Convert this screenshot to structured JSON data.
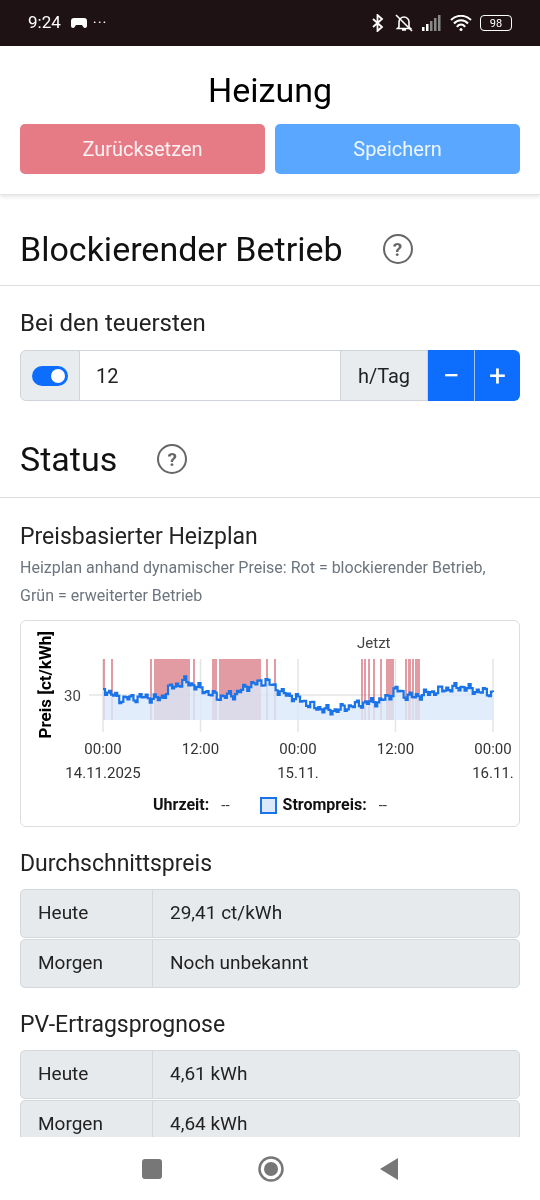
{
  "status_bar": {
    "time": "9:24",
    "more": "···",
    "battery": "98"
  },
  "header": {
    "title": "Heizung",
    "buttons": [
      {
        "label": "Zurücksetzen",
        "kind": "reset"
      },
      {
        "label": "Speichern",
        "kind": "save"
      }
    ]
  },
  "blocking": {
    "title": "Blockierender Betrieb",
    "help": "?",
    "label": "Bei den teuersten",
    "toggle_on": true,
    "value": "12",
    "unit": "h/Tag",
    "minus": "−",
    "plus": "+"
  },
  "status": {
    "title": "Status",
    "help": "?"
  },
  "plan": {
    "title": "Preisbasierter Heizplan",
    "description": "Heizplan anhand dynamischer Preise: Rot = blockierender Betrieb, Grün = erweiterter Betrieb",
    "chart": {
      "ylabel": "Preis [ct/kWh]",
      "ytick": "30",
      "now_label": "Jetzt",
      "xticks": [
        {
          "time": "00:00",
          "date": "14.11.2025"
        },
        {
          "time": "12:00"
        },
        {
          "time": "00:00",
          "date": "15.11."
        },
        {
          "time": "12:00"
        },
        {
          "time": "00:00",
          "date": "16.11."
        }
      ],
      "legend": [
        {
          "label": "Uhrzeit:",
          "value": "--",
          "kind": "plain"
        },
        {
          "label": "Strompreis:",
          "value": "--",
          "kind": "swatch"
        }
      ]
    }
  },
  "tables": [
    {
      "title": "Durchschnittspreis",
      "rows": [
        {
          "label": "Heute",
          "value": "29,41 ct/kWh"
        },
        {
          "label": "Morgen",
          "value": "Noch unbekannt"
        }
      ]
    },
    {
      "title": "PV-Ertragsprognose",
      "rows": [
        {
          "label": "Heute",
          "value": "4,61 kWh"
        },
        {
          "label": "Morgen",
          "value": "4,64 kWh"
        }
      ]
    }
  ]
}
